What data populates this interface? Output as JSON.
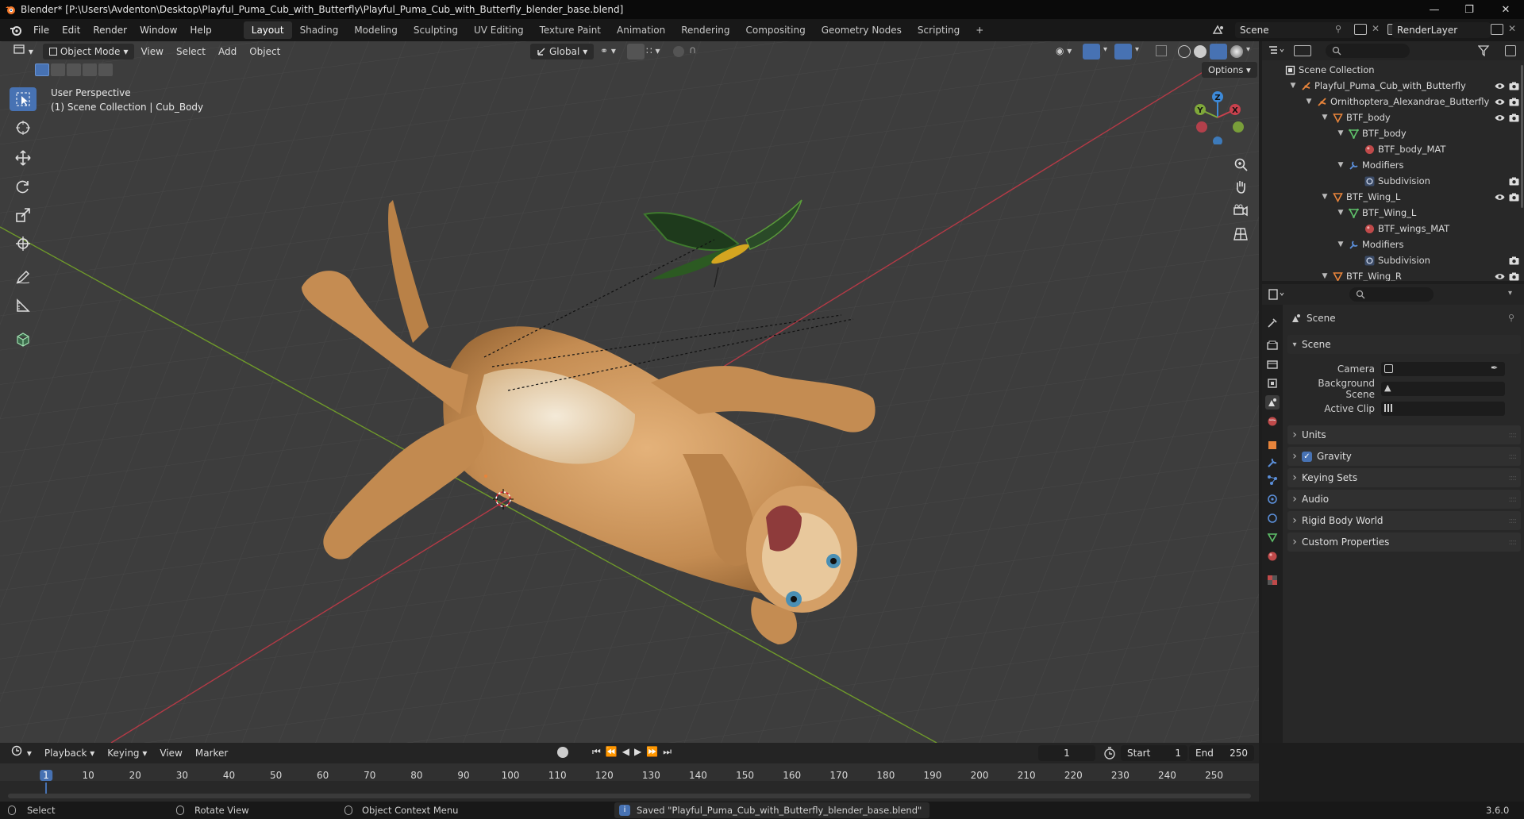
{
  "window": {
    "title": "Blender* [P:\\Users\\Avdenton\\Desktop\\Playful_Puma_Cub_with_Butterfly\\Playful_Puma_Cub_with_Butterfly_blender_base.blend]"
  },
  "menus": [
    "File",
    "Edit",
    "Render",
    "Window",
    "Help"
  ],
  "workspaces": {
    "tabs": [
      "Layout",
      "Shading",
      "Modeling",
      "Sculpting",
      "UV Editing",
      "Texture Paint",
      "Animation",
      "Rendering",
      "Compositing",
      "Geometry Nodes",
      "Scripting"
    ],
    "active": "Layout",
    "add": "+"
  },
  "scene_selector": {
    "scene": "Scene",
    "render_layer": "RenderLayer"
  },
  "viewport": {
    "mode": "Object Mode",
    "menus": [
      "View",
      "Select",
      "Add",
      "Object"
    ],
    "orientation": "Global",
    "options": "Options",
    "overlay_line1": "User Perspective",
    "overlay_line2": "(1) Scene Collection | Cub_Body",
    "gizmo": {
      "x": "X",
      "y": "Y",
      "z": "Z"
    }
  },
  "outliner": {
    "rows": [
      {
        "label": "Scene Collection",
        "icon": "collection-icon"
      },
      {
        "label": "Playful_Puma_Cub_with_Butterfly",
        "icon": "armature-icon"
      },
      {
        "label": "Ornithoptera_Alexandrae_Butterfly",
        "icon": "armature-icon"
      },
      {
        "label": "BTF_body",
        "icon": "object-icon"
      },
      {
        "label": "BTF_body",
        "icon": "mesh-icon"
      },
      {
        "label": "BTF_body_MAT",
        "icon": "material-icon"
      },
      {
        "label": "Modifiers",
        "icon": "wrench-icon"
      },
      {
        "label": "Subdivision",
        "icon": "modifier-icon"
      },
      {
        "label": "BTF_Wing_L",
        "icon": "object-icon"
      },
      {
        "label": "BTF_Wing_L",
        "icon": "mesh-icon"
      },
      {
        "label": "BTF_wings_MAT",
        "icon": "material-icon"
      },
      {
        "label": "Modifiers",
        "icon": "wrench-icon"
      },
      {
        "label": "Subdivision",
        "icon": "modifier-icon"
      },
      {
        "label": "BTF_Wing_R",
        "icon": "object-icon"
      }
    ]
  },
  "properties": {
    "context": "Scene",
    "section": "Scene",
    "fields": [
      {
        "label": "Camera"
      },
      {
        "label": "Background Scene"
      },
      {
        "label": "Active Clip"
      }
    ],
    "panels": [
      "Units",
      "Gravity",
      "Keying Sets",
      "Audio",
      "Rigid Body World",
      "Custom Properties"
    ],
    "gravity_checked": true
  },
  "timeline": {
    "menus": [
      "Playback",
      "Keying",
      "View",
      "Marker"
    ],
    "current_frame": "1",
    "start_label": "Start",
    "start": "1",
    "end_label": "End",
    "end": "250",
    "ruler": [
      "1",
      "10",
      "20",
      "30",
      "40",
      "50",
      "60",
      "70",
      "80",
      "90",
      "100",
      "110",
      "120",
      "130",
      "140",
      "150",
      "160",
      "170",
      "180",
      "190",
      "200",
      "210",
      "220",
      "230",
      "240",
      "250"
    ]
  },
  "statusbar": {
    "select": "Select",
    "rotate": "Rotate View",
    "context_menu": "Object Context Menu",
    "message": "Saved \"Playful_Puma_Cub_with_Butterfly_blender_base.blend\"",
    "version": "3.6.0"
  },
  "colors": {
    "accent": "#4772b3",
    "x_axis": "#c8414d",
    "y_axis": "#7fa83a",
    "z_axis": "#3d8ad9",
    "object_orange": "#e8843b"
  }
}
